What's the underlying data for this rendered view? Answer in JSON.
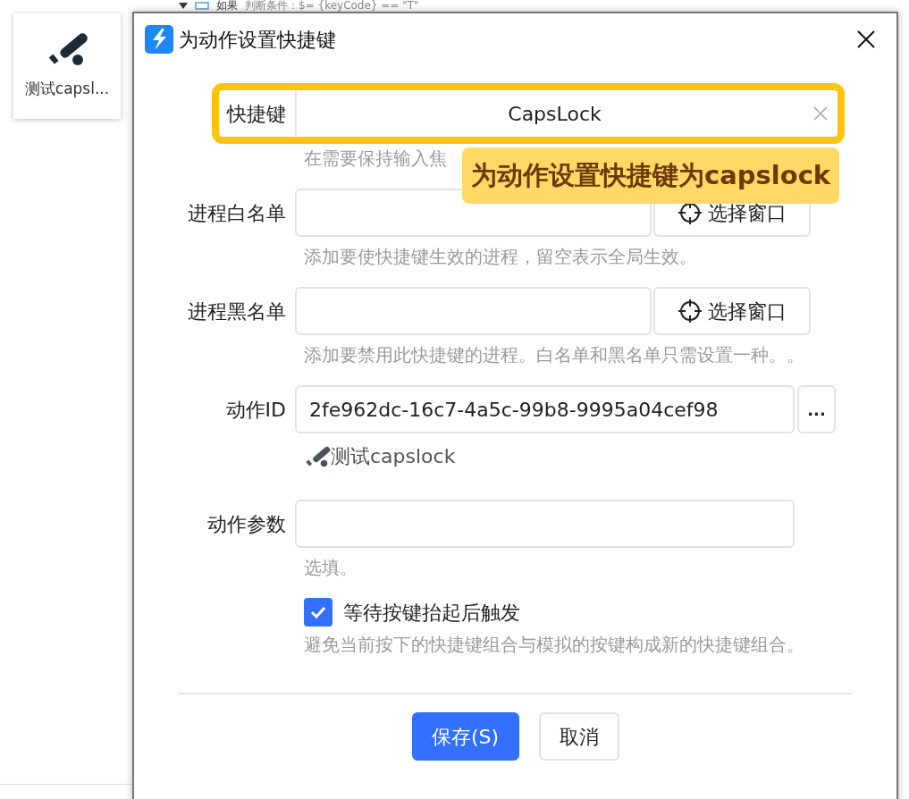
{
  "background": {
    "card": {
      "label": "测试capsl..."
    },
    "node": {
      "label": "如果",
      "condition": "判断条件：$= {keyCode} == \"T\""
    }
  },
  "dialog": {
    "title": "为动作设置快捷键",
    "shortcut": {
      "label": "快捷键",
      "value": "CapsLock",
      "highlighted": true,
      "hint": "在需要保持输入焦"
    },
    "tooltip": "为动作设置快捷键为capslock",
    "whitelist": {
      "label": "进程白名单",
      "button": "选择窗口",
      "hint": "添加要使快捷键生效的进程，留空表示全局生效。"
    },
    "blacklist": {
      "label": "进程黑名单",
      "button": "选择窗口",
      "hint": "添加要禁用此快捷键的进程。白名单和黑名单只需设置一种。。"
    },
    "action_id": {
      "label": "动作ID",
      "value": "2fe962dc-16c7-4a5c-99b8-9995a04cef98",
      "button": "...",
      "action_name": "测试capslock"
    },
    "params": {
      "label": "动作参数",
      "hint": "选填。"
    },
    "wait_release": {
      "label": "等待按键抬起后触发",
      "checked": true,
      "hint": "避免当前按下的快捷键组合与模拟的按键构成新的快捷键组合。"
    },
    "buttons": [
      {
        "label": "保存(S)",
        "kind": "primary"
      },
      {
        "label": "取消",
        "kind": "secondary"
      }
    ]
  }
}
